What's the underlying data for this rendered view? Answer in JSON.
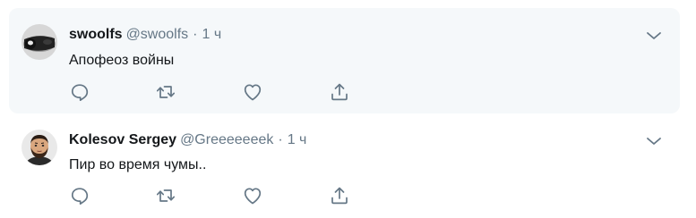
{
  "tweets": [
    {
      "author_name": "swoolfs",
      "handle": "@swoolfs",
      "separator": "·",
      "time": "1 ч",
      "text": "Апофеоз войны",
      "avatar_icon": "dark-object-avatar",
      "highlighted": true
    },
    {
      "author_name": "Kolesov Sergey",
      "handle": "@Greeeeeeek",
      "separator": "·",
      "time": "1 ч",
      "text": "Пир во время чумы..",
      "avatar_icon": "bearded-man-avatar",
      "highlighted": false
    }
  ],
  "icons": {
    "reply": "reply-icon",
    "retweet": "retweet-icon",
    "like": "like-icon",
    "share": "share-icon",
    "menu": "chevron-down-icon"
  },
  "colors": {
    "highlight_bg": "#f5f8fa",
    "text_primary": "#14171a",
    "text_secondary": "#657786"
  }
}
